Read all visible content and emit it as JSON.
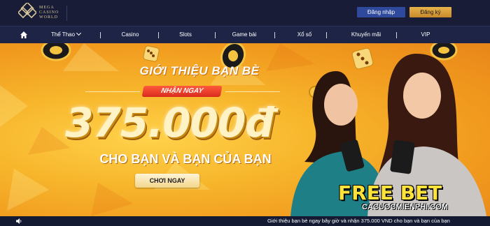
{
  "header": {
    "brand_lines": [
      "MEGA",
      "CASINO",
      "WORLD"
    ],
    "login_label": "Đăng nhập",
    "register_label": "Đăng ký"
  },
  "nav": {
    "items": [
      "Thể Thao",
      "Casino",
      "Slots",
      "Game bài",
      "Xổ số",
      "Khuyến mãi",
      "VIP"
    ]
  },
  "banner": {
    "headline": "GIỚI THIỆU BẠN BÈ",
    "badge": "NHẬN NGAY",
    "amount": "375.000đ",
    "subline": "CHO BẠN VÀ BẠN CỦA BẠN",
    "cta": "CHƠI NGAY",
    "overlay_title": "FREE BET",
    "overlay_site": "CACUOCMIENPHI.COM"
  },
  "ticker": {
    "text": "Giới thiệu bạn bè ngay bây giờ và nhận 375.000 VND cho bạn và bạn của bạn"
  },
  "colors": {
    "topbar": "#181c36",
    "nav": "#1d2446",
    "login": "#2f4a9c",
    "register": "#d9a23a",
    "banner": "#f7b62c"
  }
}
